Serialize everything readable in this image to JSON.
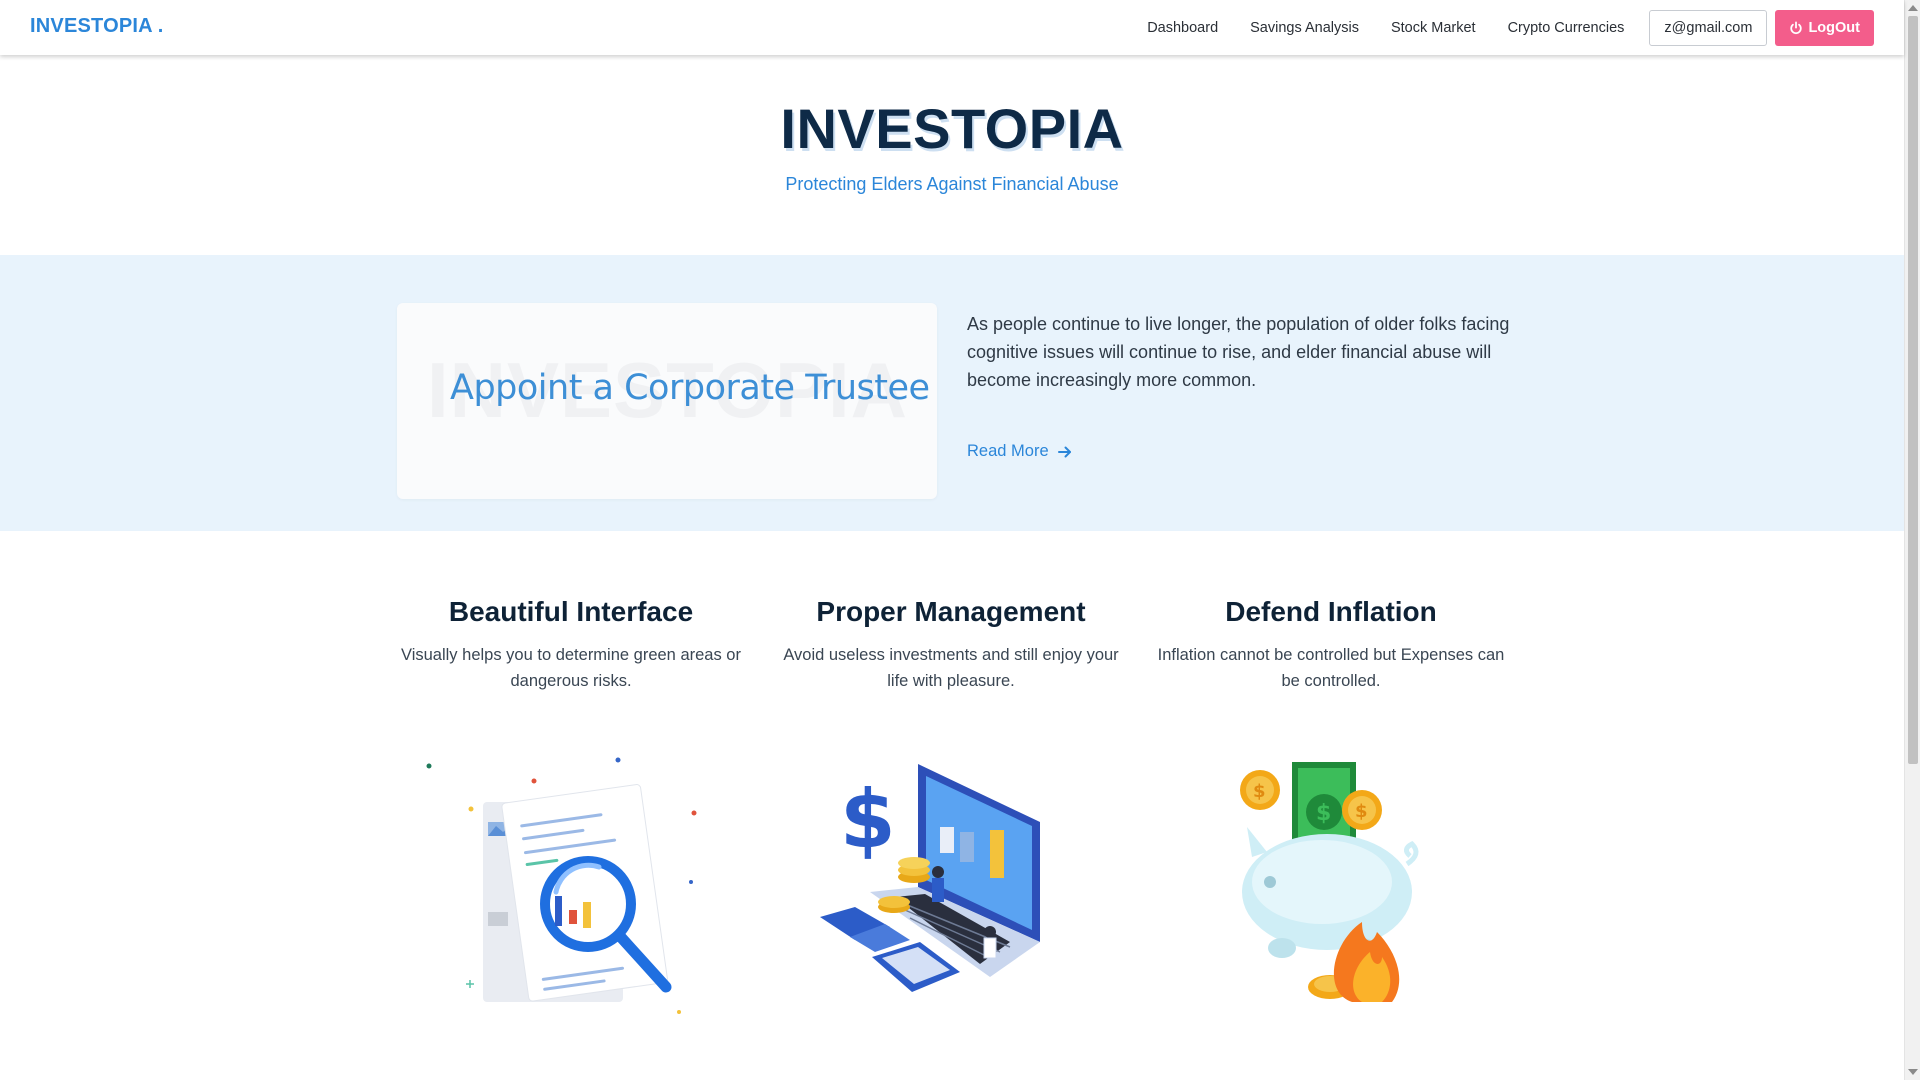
{
  "navbar": {
    "brand": "INVESTOPIA .",
    "links": [
      "Dashboard",
      "Savings Analysis",
      "Stock Market",
      "Crypto Currencies"
    ],
    "user_email": "z@gmail.com",
    "logout_label": "LogOut",
    "logout_icon": "power-icon"
  },
  "hero": {
    "title": "INVESTOPIA",
    "subtitle": "Protecting Elders Against Financial Abuse"
  },
  "band": {
    "card_watermark": "INVESTOPIA",
    "card_title": "Appoint a Corporate Trustee",
    "description": "As people continue to live longer, the population of older folks facing cognitive issues will continue to rise, and elder financial abuse will become increasingly more common.",
    "read_more": "Read More",
    "read_more_icon": "arrow-right-icon"
  },
  "features": [
    {
      "title": "Beautiful Interface",
      "text": "Visually helps you to determine green areas or dangerous risks.",
      "illustration": "magnifier-document-illustration"
    },
    {
      "title": "Proper Management",
      "text": "Avoid useless investments and still enjoy your life with pleasure.",
      "illustration": "laptop-finance-illustration"
    },
    {
      "title": "Defend Inflation",
      "text": "Inflation cannot be controlled but Expenses can be controlled.",
      "illustration": "piggy-bank-fire-illustration"
    }
  ],
  "colors": {
    "accent": "#2b86d9",
    "logout": "#f35d8b",
    "band_background": "#e8f3fc",
    "heading": "#0e2a47"
  }
}
